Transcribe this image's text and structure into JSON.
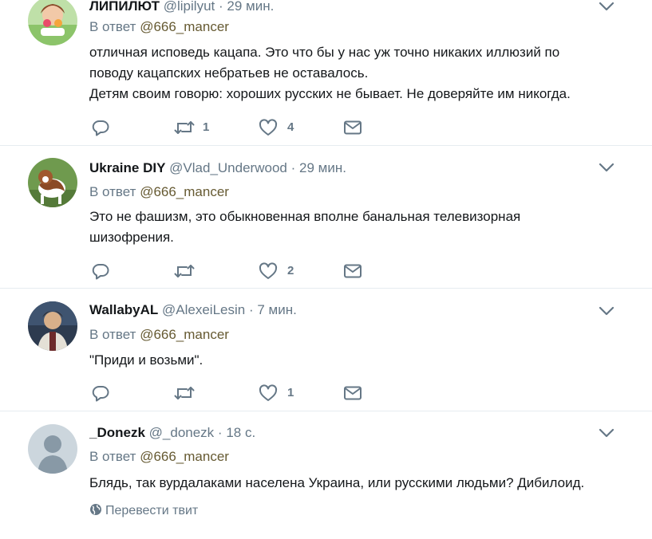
{
  "reply_prefix": "В ответ",
  "tweets": [
    {
      "name": "ЛИПИЛЮТ",
      "handle": "@lipilyut",
      "time": "29 мин.",
      "reply_to": "@666_mancer",
      "text_lines": [
        "отличная исповедь кацапа. Это что бы у нас уж точно никаких иллюзий по",
        "поводу кацапских небратьев не оставалось.",
        "Детям своим говорю: хороших русских не бывает. Не доверяйте им никогда."
      ],
      "retweets": "1",
      "likes": "4"
    },
    {
      "name": "Ukraine DIY",
      "handle": "@Vlad_Underwood",
      "time": "29 мин.",
      "reply_to": "@666_mancer",
      "text_lines": [
        "Это не фашизм, это обыкновенная  вполне банальная телевизорная",
        "шизофрения."
      ],
      "retweets": "",
      "likes": "2"
    },
    {
      "name": "WallabyAL",
      "handle": "@AlexeiLesin",
      "time": "7 мин.",
      "reply_to": "@666_mancer",
      "text_lines": [
        "\"Приди и возьми\"."
      ],
      "retweets": "",
      "likes": "1"
    },
    {
      "name": "_Donezk",
      "handle": "@_donezk",
      "time": "18 с.",
      "reply_to": "@666_mancer",
      "text_lines": [
        "Блядь, так вурдалаками населена Украина, или русскими людьми? Дибилоид."
      ],
      "translate_label": "Перевести твит"
    }
  ],
  "colors": {
    "mention": "#665a32",
    "muted": "#657786",
    "divider": "#e6ecf0"
  }
}
